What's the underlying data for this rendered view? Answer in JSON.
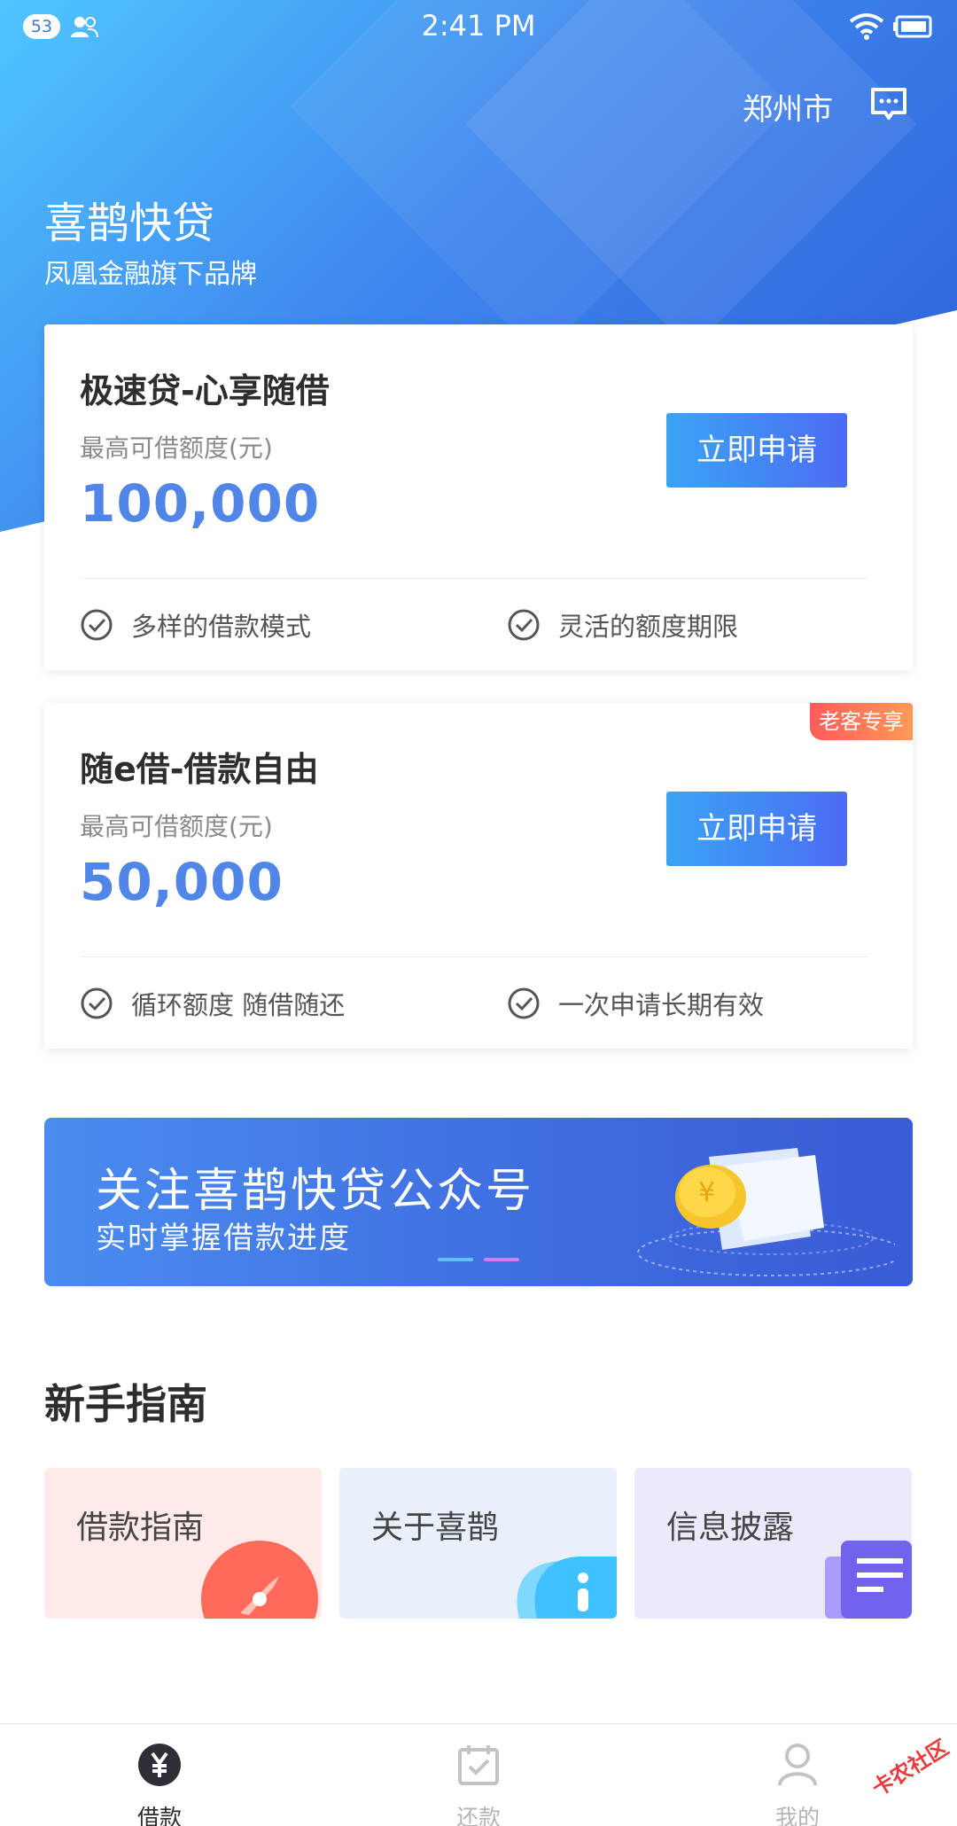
{
  "status_bar": {
    "notification_count": "53",
    "time": "2:41 PM",
    "icons": [
      "people-icon",
      "wifi-icon",
      "battery-icon"
    ]
  },
  "header": {
    "city": "郑州市",
    "message_icon": "message-icon",
    "brand_name": "喜鹊快贷",
    "brand_subtitle": "凤凰金融旗下品牌"
  },
  "loans": [
    {
      "title": "极速贷-心享随借",
      "limit_label": "最高可借额度(元)",
      "amount": "100,000",
      "button": "立即申请",
      "features": [
        "多样的借款模式",
        "灵活的额度期限"
      ]
    },
    {
      "title": "随e借-借款自由",
      "limit_label": "最高可借额度(元)",
      "amount": "50,000",
      "button": "立即申请",
      "tag": "老客专享",
      "features": [
        "循环额度 随借随还",
        "一次申请长期有效"
      ]
    }
  ],
  "banner": {
    "title": "关注喜鹊快贷公众号",
    "subtitle": "实时掌握借款进度"
  },
  "guide": {
    "title": "新手指南",
    "items": [
      "借款指南",
      "关于喜鹊",
      "信息披露"
    ]
  },
  "tabs": [
    {
      "label": "借款",
      "icon": "yuan-icon",
      "active": true
    },
    {
      "label": "还款",
      "icon": "calendar-check-icon",
      "active": false
    },
    {
      "label": "我的",
      "icon": "person-icon",
      "active": false
    }
  ],
  "watermark": "卡农社区",
  "colors": {
    "accent": "#4f86e8",
    "button_start": "#3aa4f6",
    "button_end": "#4c6cf3",
    "tag_start": "#ff5b5b",
    "tag_end": "#ff9a58"
  }
}
